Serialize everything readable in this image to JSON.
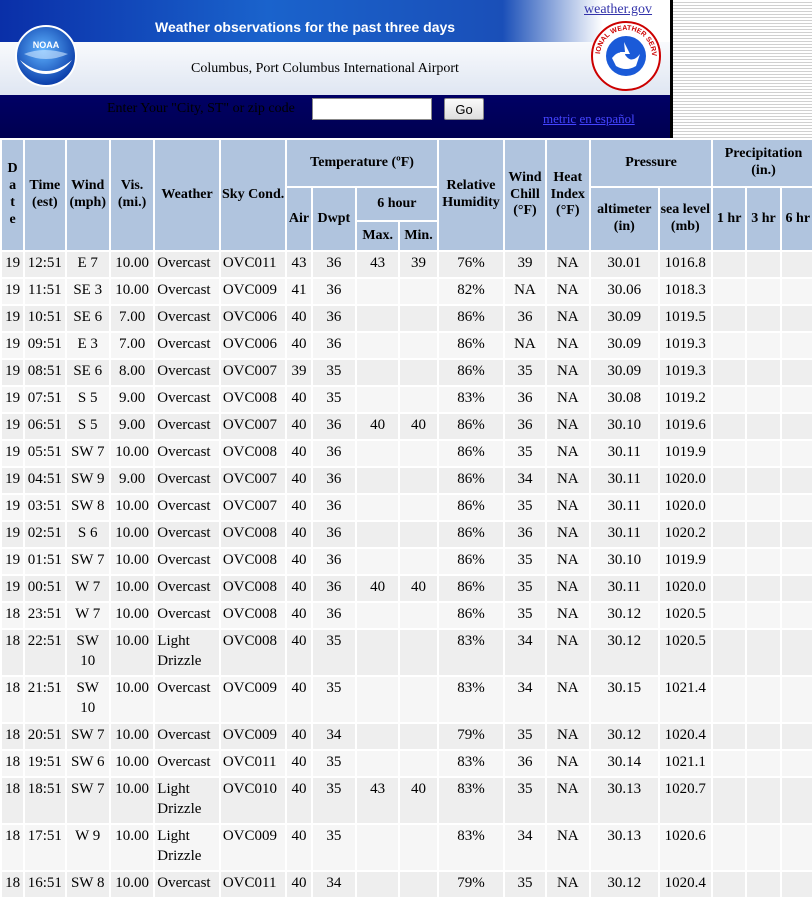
{
  "header": {
    "title": "Weather observations for the past three days",
    "station": "Columbus, Port Columbus International Airport",
    "weather_gov_link": "weather.gov",
    "noaa_logo_text": "NOAA",
    "nws_logo_text": "NATIONAL WEATHER SERVICE",
    "search_label": "Enter Your \"City, ST\" or zip code",
    "search_value": "",
    "go_label": "Go",
    "metric_link": "metric",
    "espanol_link": "en español"
  },
  "colors": {
    "header_blue": "#00006e",
    "table_header": "#b0c4de",
    "row_odd": "#eeeeee",
    "row_even": "#f6f6f6"
  },
  "table": {
    "headers": {
      "date": "D\na\nt\ne",
      "time": "Time (est)",
      "wind": "Wind (mph)",
      "vis": "Vis. (mi.)",
      "weather": "Weather",
      "sky": "Sky Cond.",
      "temperature": "Temperature (ºF)",
      "air": "Air",
      "dwpt": "Dwpt",
      "six_hour": "6 hour",
      "max": "Max.",
      "min": "Min.",
      "humidity": "Relative Humidity",
      "wind_chill": "Wind Chill (°F)",
      "heat_index": "Heat Index (°F)",
      "pressure": "Pressure",
      "altimeter": "altimeter (in)",
      "sea_level": "sea level (mb)",
      "precipitation": "Precipitation (in.)",
      "p1": "1 hr",
      "p3": "3 hr",
      "p6": "6 hr"
    },
    "rows": [
      [
        "19",
        "12:51",
        "E 7",
        "10.00",
        "Overcast",
        "OVC011",
        "43",
        "36",
        "43",
        "39",
        "76%",
        "39",
        "NA",
        "30.01",
        "1016.8",
        "",
        "",
        ""
      ],
      [
        "19",
        "11:51",
        "SE 3",
        "10.00",
        "Overcast",
        "OVC009",
        "41",
        "36",
        "",
        "",
        "82%",
        "NA",
        "NA",
        "30.06",
        "1018.3",
        "",
        "",
        ""
      ],
      [
        "19",
        "10:51",
        "SE 6",
        "7.00",
        "Overcast",
        "OVC006",
        "40",
        "36",
        "",
        "",
        "86%",
        "36",
        "NA",
        "30.09",
        "1019.5",
        "",
        "",
        ""
      ],
      [
        "19",
        "09:51",
        "E 3",
        "7.00",
        "Overcast",
        "OVC006",
        "40",
        "36",
        "",
        "",
        "86%",
        "NA",
        "NA",
        "30.09",
        "1019.3",
        "",
        "",
        ""
      ],
      [
        "19",
        "08:51",
        "SE 6",
        "8.00",
        "Overcast",
        "OVC007",
        "39",
        "35",
        "",
        "",
        "86%",
        "35",
        "NA",
        "30.09",
        "1019.3",
        "",
        "",
        ""
      ],
      [
        "19",
        "07:51",
        "S 5",
        "9.00",
        "Overcast",
        "OVC008",
        "40",
        "35",
        "",
        "",
        "83%",
        "36",
        "NA",
        "30.08",
        "1019.2",
        "",
        "",
        ""
      ],
      [
        "19",
        "06:51",
        "S 5",
        "9.00",
        "Overcast",
        "OVC007",
        "40",
        "36",
        "40",
        "40",
        "86%",
        "36",
        "NA",
        "30.10",
        "1019.6",
        "",
        "",
        ""
      ],
      [
        "19",
        "05:51",
        "SW 7",
        "10.00",
        "Overcast",
        "OVC008",
        "40",
        "36",
        "",
        "",
        "86%",
        "35",
        "NA",
        "30.11",
        "1019.9",
        "",
        "",
        ""
      ],
      [
        "19",
        "04:51",
        "SW 9",
        "9.00",
        "Overcast",
        "OVC007",
        "40",
        "36",
        "",
        "",
        "86%",
        "34",
        "NA",
        "30.11",
        "1020.0",
        "",
        "",
        ""
      ],
      [
        "19",
        "03:51",
        "SW 8",
        "10.00",
        "Overcast",
        "OVC007",
        "40",
        "36",
        "",
        "",
        "86%",
        "35",
        "NA",
        "30.11",
        "1020.0",
        "",
        "",
        ""
      ],
      [
        "19",
        "02:51",
        "S 6",
        "10.00",
        "Overcast",
        "OVC008",
        "40",
        "36",
        "",
        "",
        "86%",
        "36",
        "NA",
        "30.11",
        "1020.2",
        "",
        "",
        ""
      ],
      [
        "19",
        "01:51",
        "SW 7",
        "10.00",
        "Overcast",
        "OVC008",
        "40",
        "36",
        "",
        "",
        "86%",
        "35",
        "NA",
        "30.10",
        "1019.9",
        "",
        "",
        ""
      ],
      [
        "19",
        "00:51",
        "W 7",
        "10.00",
        "Overcast",
        "OVC008",
        "40",
        "36",
        "40",
        "40",
        "86%",
        "35",
        "NA",
        "30.11",
        "1020.0",
        "",
        "",
        ""
      ],
      [
        "18",
        "23:51",
        "W 7",
        "10.00",
        "Overcast",
        "OVC008",
        "40",
        "36",
        "",
        "",
        "86%",
        "35",
        "NA",
        "30.12",
        "1020.5",
        "",
        "",
        ""
      ],
      [
        "18",
        "22:51",
        "SW 10",
        "10.00",
        "Light Drizzle",
        "OVC008",
        "40",
        "35",
        "",
        "",
        "83%",
        "34",
        "NA",
        "30.12",
        "1020.5",
        "",
        "",
        ""
      ],
      [
        "18",
        "21:51",
        "SW 10",
        "10.00",
        "Overcast",
        "OVC009",
        "40",
        "35",
        "",
        "",
        "83%",
        "34",
        "NA",
        "30.15",
        "1021.4",
        "",
        "",
        ""
      ],
      [
        "18",
        "20:51",
        "SW 7",
        "10.00",
        "Overcast",
        "OVC009",
        "40",
        "34",
        "",
        "",
        "79%",
        "35",
        "NA",
        "30.12",
        "1020.4",
        "",
        "",
        ""
      ],
      [
        "18",
        "19:51",
        "SW 6",
        "10.00",
        "Overcast",
        "OVC011",
        "40",
        "35",
        "",
        "",
        "83%",
        "36",
        "NA",
        "30.14",
        "1021.1",
        "",
        "",
        ""
      ],
      [
        "18",
        "18:51",
        "SW 7",
        "10.00",
        "Light Drizzle",
        "OVC010",
        "40",
        "35",
        "43",
        "40",
        "83%",
        "35",
        "NA",
        "30.13",
        "1020.7",
        "",
        "",
        ""
      ],
      [
        "18",
        "17:51",
        "W 9",
        "10.00",
        "Light Drizzle",
        "OVC009",
        "40",
        "35",
        "",
        "",
        "83%",
        "34",
        "NA",
        "30.13",
        "1020.6",
        "",
        "",
        ""
      ],
      [
        "18",
        "16:51",
        "SW 8",
        "10.00",
        "Overcast",
        "OVC011",
        "40",
        "34",
        "",
        "",
        "79%",
        "35",
        "NA",
        "30.12",
        "1020.4",
        "",
        "",
        ""
      ]
    ]
  }
}
